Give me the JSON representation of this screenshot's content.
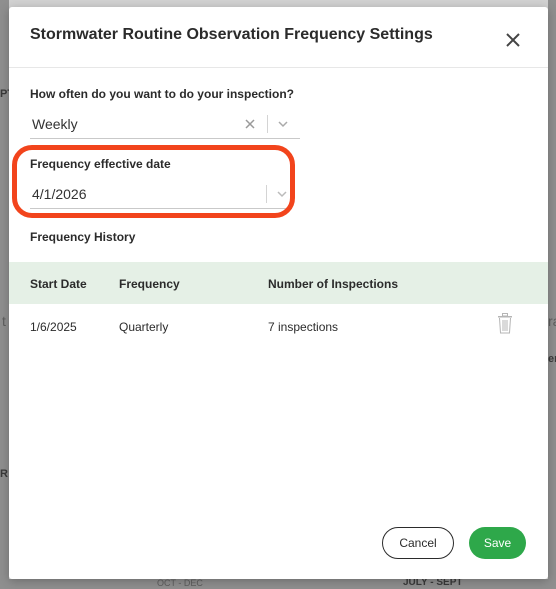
{
  "background": {
    "frag_left_1": "PT",
    "frag_left_2": "t",
    "frag_left_3": "R",
    "frag_right_1": "ra",
    "frag_right_2": "er",
    "footer_left": "OCT - DEC",
    "footer_right": "JULY - SEPT"
  },
  "modal": {
    "title": "Stormwater Routine Observation Frequency Settings",
    "close_icon": "close-icon"
  },
  "inspection_frequency": {
    "label": "How often do you want to do your inspection?",
    "value": "Weekly"
  },
  "effective_date": {
    "label": "Frequency effective date",
    "value": "4/1/2026"
  },
  "history": {
    "title": "Frequency History",
    "columns": [
      "Start Date",
      "Frequency",
      "Number of Inspections"
    ],
    "rows": [
      {
        "start_date": "1/6/2025",
        "frequency": "Quarterly",
        "inspections": "7 inspections"
      }
    ]
  },
  "footer": {
    "cancel_label": "Cancel",
    "save_label": "Save"
  },
  "colors": {
    "highlight": "#f2441c",
    "save_button": "#2ea84a",
    "table_header_bg": "#e5f0e6"
  }
}
